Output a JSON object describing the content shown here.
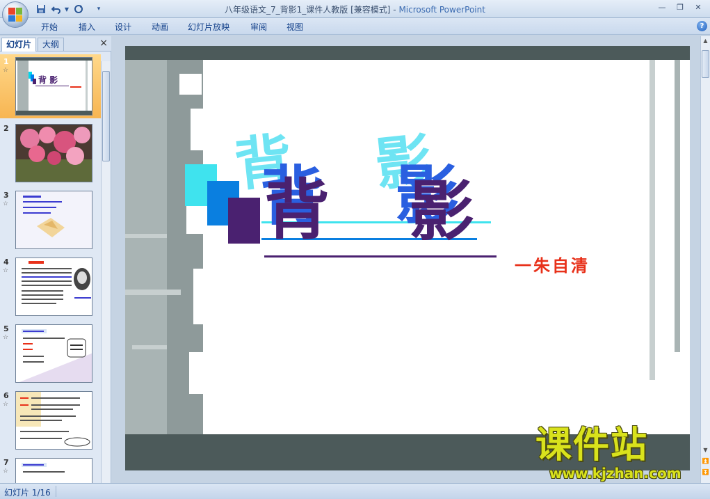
{
  "window": {
    "title": "八年级语文_7_背影1_课件人教版 [兼容模式] - ",
    "app_name": "Microsoft PowerPoint"
  },
  "qat": {
    "save_icon": "save-icon",
    "undo_icon": "undo-icon",
    "redo_icon": "redo-icon"
  },
  "ribbon": {
    "tabs": [
      "开始",
      "插入",
      "设计",
      "动画",
      "幻灯片放映",
      "审阅",
      "视图"
    ]
  },
  "pane": {
    "tabs": [
      "幻灯片",
      "大纲"
    ],
    "close": "×"
  },
  "thumbnails": [
    {
      "num": "1",
      "star": "☆"
    },
    {
      "num": "2",
      "star": ""
    },
    {
      "num": "3",
      "star": "☆"
    },
    {
      "num": "4",
      "star": "☆"
    },
    {
      "num": "5",
      "star": "☆"
    },
    {
      "num": "6",
      "star": "☆"
    },
    {
      "num": "7",
      "star": "☆"
    }
  ],
  "slide": {
    "title_char1": "背",
    "title_char2": "影",
    "author": "一朱自清"
  },
  "status": {
    "text": "幻灯片 1/16"
  },
  "watermark": {
    "title": "课件站",
    "url": "www.kjzhan.com"
  },
  "colors": {
    "accent_orange": "#f7b552",
    "title_purple": "#4a2170",
    "author_red": "#e8311a"
  }
}
